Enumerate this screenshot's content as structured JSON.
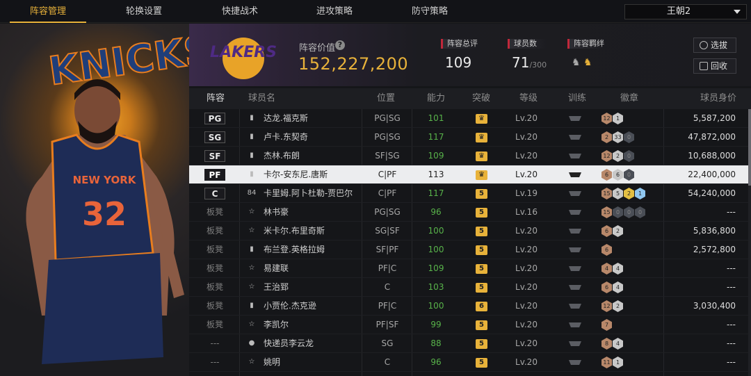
{
  "nav": {
    "tabs": [
      "阵容管理",
      "轮换设置",
      "快捷战术",
      "进攻策略",
      "防守策略"
    ],
    "active_index": 0,
    "lineup_select": "王朝2"
  },
  "header": {
    "team_logo_text": "LAKERS",
    "value_label": "阵容价值",
    "value": "152,227,200",
    "stats": [
      {
        "label": "阵容总评",
        "value": "109",
        "sub": ""
      },
      {
        "label": "球员数",
        "value": "71",
        "sub": "/300"
      },
      {
        "label": "阵容羁绊",
        "value": "",
        "sub": ""
      }
    ],
    "buttons": {
      "select": "选拔",
      "recycle": "回收"
    }
  },
  "table": {
    "columns": [
      "阵容",
      "球员名",
      "位置",
      "能力",
      "突破",
      "等级",
      "训练",
      "徽章",
      "球员身价"
    ],
    "rows": [
      {
        "pos": "PG",
        "type": "start",
        "rank_icon": "bars-icon",
        "name": "达龙.福克斯",
        "ppos": "PG|SG",
        "ovr": "101",
        "breakthrough": "",
        "level": "Lv.20",
        "badges": [
          "12",
          "1"
        ],
        "badge_colors": [
          "br",
          "si"
        ],
        "price": "5,587,200"
      },
      {
        "pos": "SG",
        "type": "start",
        "rank_icon": "bars-icon",
        "name": "卢卡.东契奇",
        "ppos": "PG|SG",
        "ovr": "117",
        "breakthrough": "",
        "level": "Lv.20",
        "badges": [
          "2",
          "33",
          "0"
        ],
        "badge_colors": [
          "br",
          "si",
          "em"
        ],
        "price": "47,872,000"
      },
      {
        "pos": "SF",
        "type": "start",
        "rank_icon": "bars-icon",
        "name": "杰林.布朗",
        "ppos": "SF|SG",
        "ovr": "109",
        "breakthrough": "",
        "level": "Lv.20",
        "badges": [
          "12",
          "2",
          "0"
        ],
        "badge_colors": [
          "br",
          "si",
          "em"
        ],
        "price": "10,688,000"
      },
      {
        "pos": "PF",
        "type": "start",
        "rank_icon": "bars-icon",
        "name": "卡尔-安东尼.唐斯",
        "ppos": "C|PF",
        "ovr": "113",
        "breakthrough": "",
        "level": "Lv.20",
        "badges": [
          "6",
          "6",
          "0"
        ],
        "badge_colors": [
          "br",
          "si",
          "em"
        ],
        "price": "22,400,000",
        "selected": true
      },
      {
        "pos": "C",
        "type": "start",
        "rank_icon": "84",
        "name": "卡里姆.阿卜杜勒-贾巴尔",
        "ppos": "C|PF",
        "ovr": "117",
        "breakthrough": "5",
        "level": "Lv.19",
        "badges": [
          "15",
          "5",
          "2",
          "1"
        ],
        "badge_colors": [
          "br",
          "si",
          "go",
          "hf"
        ],
        "price": "54,240,000"
      },
      {
        "pos": "板凳",
        "type": "bench",
        "rank_icon": "star-icon",
        "name": "林书豪",
        "ppos": "PG|SG",
        "ovr": "96",
        "breakthrough": "5",
        "level": "Lv.16",
        "badges": [
          "15",
          "0",
          "0",
          "0"
        ],
        "badge_colors": [
          "br",
          "em",
          "em",
          "em"
        ],
        "price": "---"
      },
      {
        "pos": "板凳",
        "type": "bench",
        "rank_icon": "star-icon",
        "name": "米卡尔.布里奇斯",
        "ppos": "SG|SF",
        "ovr": "100",
        "breakthrough": "5",
        "level": "Lv.20",
        "badges": [
          "6",
          "2"
        ],
        "badge_colors": [
          "br",
          "si"
        ],
        "price": "5,836,800"
      },
      {
        "pos": "板凳",
        "type": "bench",
        "rank_icon": "bars-icon",
        "name": "布兰登.英格拉姆",
        "ppos": "SF|PF",
        "ovr": "100",
        "breakthrough": "5",
        "level": "Lv.20",
        "badges": [
          "6"
        ],
        "badge_colors": [
          "br"
        ],
        "price": "2,572,800"
      },
      {
        "pos": "板凳",
        "type": "bench",
        "rank_icon": "star-icon",
        "name": "易建联",
        "ppos": "PF|C",
        "ovr": "109",
        "breakthrough": "5",
        "level": "Lv.20",
        "badges": [
          "4",
          "4"
        ],
        "badge_colors": [
          "br",
          "si"
        ],
        "price": "---"
      },
      {
        "pos": "板凳",
        "type": "bench",
        "rank_icon": "star-icon",
        "name": "王治郅",
        "ppos": "C",
        "ovr": "103",
        "breakthrough": "5",
        "level": "Lv.20",
        "badges": [
          "6",
          "4"
        ],
        "badge_colors": [
          "br",
          "si"
        ],
        "price": "---"
      },
      {
        "pos": "板凳",
        "type": "bench",
        "rank_icon": "bars-icon",
        "name": "小贾伦.杰克逊",
        "ppos": "PF|C",
        "ovr": "100",
        "breakthrough": "6",
        "level": "Lv.20",
        "badges": [
          "12",
          "2"
        ],
        "badge_colors": [
          "br",
          "si"
        ],
        "price": "3,030,400"
      },
      {
        "pos": "板凳",
        "type": "bench",
        "rank_icon": "star-icon",
        "name": "李凯尔",
        "ppos": "PF|SF",
        "ovr": "99",
        "breakthrough": "5",
        "level": "Lv.20",
        "badges": [
          "7"
        ],
        "badge_colors": [
          "br"
        ],
        "price": "---"
      },
      {
        "pos": "---",
        "type": "bench",
        "rank_icon": "person-icon",
        "name": "快递员李云龙",
        "ppos": "SG",
        "ovr": "88",
        "breakthrough": "5",
        "level": "Lv.20",
        "badges": [
          "8",
          "4"
        ],
        "badge_colors": [
          "br",
          "si"
        ],
        "price": "---"
      },
      {
        "pos": "---",
        "type": "bench",
        "rank_icon": "star-icon",
        "name": "姚明",
        "ppos": "C",
        "ovr": "96",
        "breakthrough": "5",
        "level": "Lv.20",
        "badges": [
          "11",
          "1"
        ],
        "badge_colors": [
          "br",
          "si"
        ],
        "price": "---"
      }
    ]
  },
  "portrait": {
    "jersey_text": "NEW YORK",
    "jersey_number": "32",
    "bg_text": "KNICKS"
  },
  "colors": {
    "accent": "#e8b23a",
    "ovr_green": "#58b34a",
    "tag_red": "#c0283a"
  }
}
